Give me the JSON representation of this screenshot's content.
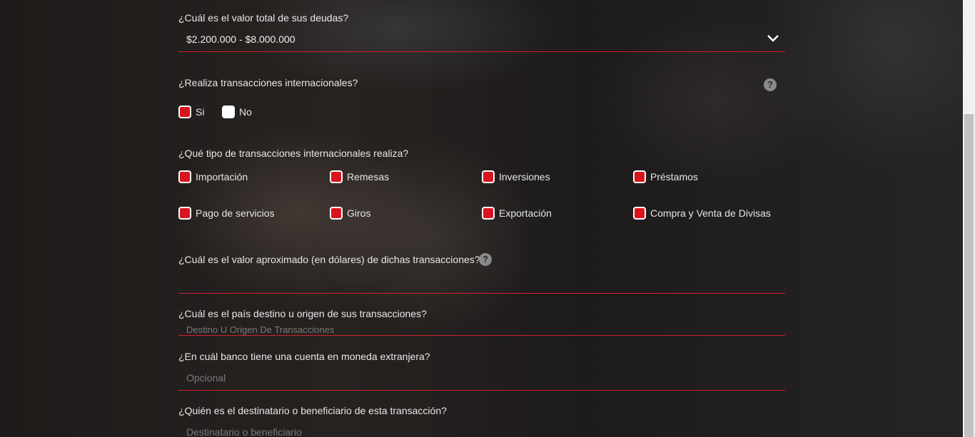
{
  "debts": {
    "question": "¿Cuál es el valor total de sus deudas?",
    "selected": "$2.200.000 - $8.000.000"
  },
  "international": {
    "question": "¿Realiza transacciones internacionales?",
    "help": "?",
    "options": [
      {
        "label": "Si",
        "checked": true
      },
      {
        "label": "No",
        "checked": false
      }
    ]
  },
  "types": {
    "question": "¿Qué tipo de transacciones internacionales realiza?",
    "options": [
      {
        "label": "Importación",
        "checked": true
      },
      {
        "label": "Remesas",
        "checked": true
      },
      {
        "label": "Inversiones",
        "checked": true
      },
      {
        "label": "Préstamos",
        "checked": true
      },
      {
        "label": "Pago de servicios",
        "checked": true
      },
      {
        "label": "Giros",
        "checked": true
      },
      {
        "label": "Exportación",
        "checked": true
      },
      {
        "label": "Compra y Venta de Divisas",
        "checked": true
      }
    ]
  },
  "amount": {
    "question": "¿Cuál es el valor aproximado (en dólares) de dichas transacciones?",
    "help": "?",
    "value": ""
  },
  "country": {
    "question": "¿Cuál es el país destino u origen de sus transacciones?",
    "placeholder": "Destino U Origen De Transacciones"
  },
  "bank": {
    "question": "¿En cuál banco tiene una cuenta en moneda extranjera?",
    "placeholder": "Opcional"
  },
  "beneficiary": {
    "question": "¿Quién es el destinatario o beneficiario de esta transacción?",
    "placeholder": "Destinatario o beneficiario"
  },
  "colors": {
    "accent": "#d9141e",
    "text": "#e6e6e6",
    "placeholder": "#7a7a7a"
  }
}
